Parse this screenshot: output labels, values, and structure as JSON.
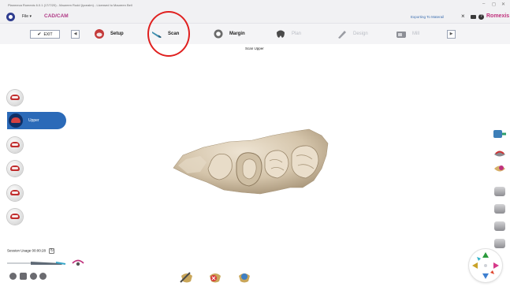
{
  "window": {
    "title": "Planmeca Romexis 6.0.1 (17/7/20) - Maureen Rudd (lycealm) - Licensed to Maureen Bell",
    "controls": [
      "–",
      "◻",
      "✕"
    ]
  },
  "menubar": {
    "file_label": "File ▾",
    "app_title": "CAD/CAM",
    "export_status": "Exporting To Materail",
    "brand": "Romexis"
  },
  "toolbar": {
    "exit_label": "EXIT",
    "steps": [
      {
        "label": "Setup",
        "state": "done"
      },
      {
        "label": "Scan",
        "state": "active"
      },
      {
        "label": "Margin",
        "state": "enabled"
      },
      {
        "label": "Plan",
        "state": "disabled"
      },
      {
        "label": "Design",
        "state": "disabled"
      },
      {
        "label": "Mill",
        "state": "disabled"
      }
    ],
    "prev_arrow": "◀",
    "next_arrow": "▶"
  },
  "workspace": {
    "scan_label": "Scan Upper",
    "selected_jaw": "Upper"
  },
  "session": {
    "label": "Session Usage",
    "time": "00:00:28"
  },
  "colors": {
    "accent_blue": "#2b6ab8",
    "brand_pink": "#c0327d",
    "highlight_red": "#e0201f",
    "tooth_beige": "#d9cbb5"
  }
}
